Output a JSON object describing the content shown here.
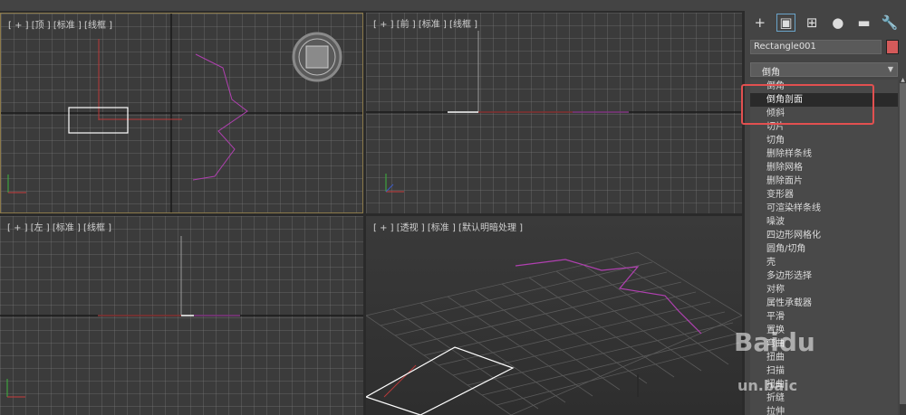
{
  "viewports": {
    "top": {
      "label": "[ + ] [顶 ] [标准 ] [线框 ]"
    },
    "front": {
      "label": "[ + ] [前 ] [标准 ] [线框 ]"
    },
    "left": {
      "label": "[ + ] [左 ] [标准 ] [线框 ]"
    },
    "perspective": {
      "label": "[ + ] [透视 ] [标准 ] [默认明暗处理 ]"
    }
  },
  "command_panel": {
    "tabs": [
      {
        "icon": "create-icon",
        "glyph": "+"
      },
      {
        "icon": "modify-icon",
        "glyph": "▣"
      },
      {
        "icon": "hierarchy-icon",
        "glyph": "⊞"
      },
      {
        "icon": "motion-icon",
        "glyph": "●"
      },
      {
        "icon": "display-icon",
        "glyph": "▬"
      },
      {
        "icon": "utilities-icon",
        "glyph": "🔧"
      }
    ],
    "object_name": "Rectangle001",
    "object_color": "#d45a5a",
    "modifier_dropdown": "倒角",
    "modifier_list": [
      "倒角",
      "倒角剖面",
      "倾斜",
      "切片",
      "切角",
      "删除样条线",
      "删除网格",
      "删除面片",
      "变形器",
      "可渲染样条线",
      "噪波",
      "四边形网格化",
      "圆角/切角",
      "壳",
      "多边形选择",
      "对称",
      "属性承载器",
      "平滑",
      "置换",
      "弯曲",
      "扭曲",
      "扫描",
      "扭曲",
      "折缝",
      "拉伸"
    ],
    "selected_index": 1
  },
  "watermark": {
    "line1": "Baidu",
    "line2": "un.baic"
  }
}
